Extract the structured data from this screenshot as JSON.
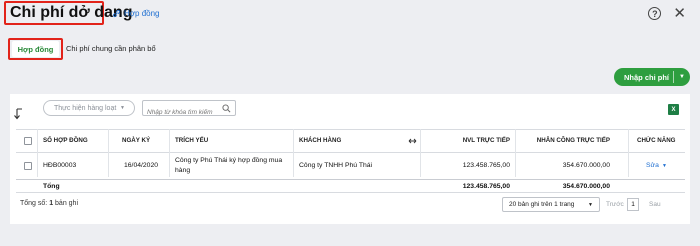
{
  "header": {
    "title": "Chi phí dở dang",
    "help_link": "Hợp đồng"
  },
  "tabs": [
    {
      "label": "Hợp đồng",
      "active": true
    },
    {
      "label": "Chi phí chung cần phân bổ",
      "active": false
    }
  ],
  "actions": {
    "import_label": "Nhập chi phí"
  },
  "toolbar": {
    "bulk_label": "Thực hiện hàng loạt",
    "search_placeholder": "Nhập từ khóa tìm kiếm",
    "excel_icon": "X"
  },
  "table": {
    "columns": [
      "SỐ HỢP ĐỒNG",
      "NGÀY KÝ",
      "TRÍCH YẾU",
      "KHÁCH HÀNG",
      "NVL TRỰC TIẾP",
      "NHÂN CÔNG TRỰC TIẾP",
      "CHỨC NĂNG"
    ],
    "rows": [
      {
        "so_hop_dong": "HĐB00003",
        "ngay_ky": "16/04/2020",
        "trich_yeu_line1": "Công ty Phú Thái ký hợp đồng mua",
        "trich_yeu_line2": "hàng",
        "khach_hang": "Công ty TNHH Phú Thái",
        "nvl": "123.458.765,00",
        "nhan_cong": "354.670.000,00",
        "action": "Sửa"
      }
    ],
    "total": {
      "label": "Tổng",
      "nvl": "123.458.765,00",
      "nhan_cong": "354.670.000,00"
    }
  },
  "footer": {
    "total_prefix": "Tổng số: ",
    "total_count": "1",
    "total_suffix": " bản ghi",
    "page_size": "20 bản ghi trên 1 trang",
    "prev": "Trước",
    "current_page": "1",
    "next": "Sau"
  },
  "colors": {
    "accent_green": "#2e9e3f",
    "link_blue": "#1f6fd1",
    "highlight_red": "#e2231a"
  }
}
